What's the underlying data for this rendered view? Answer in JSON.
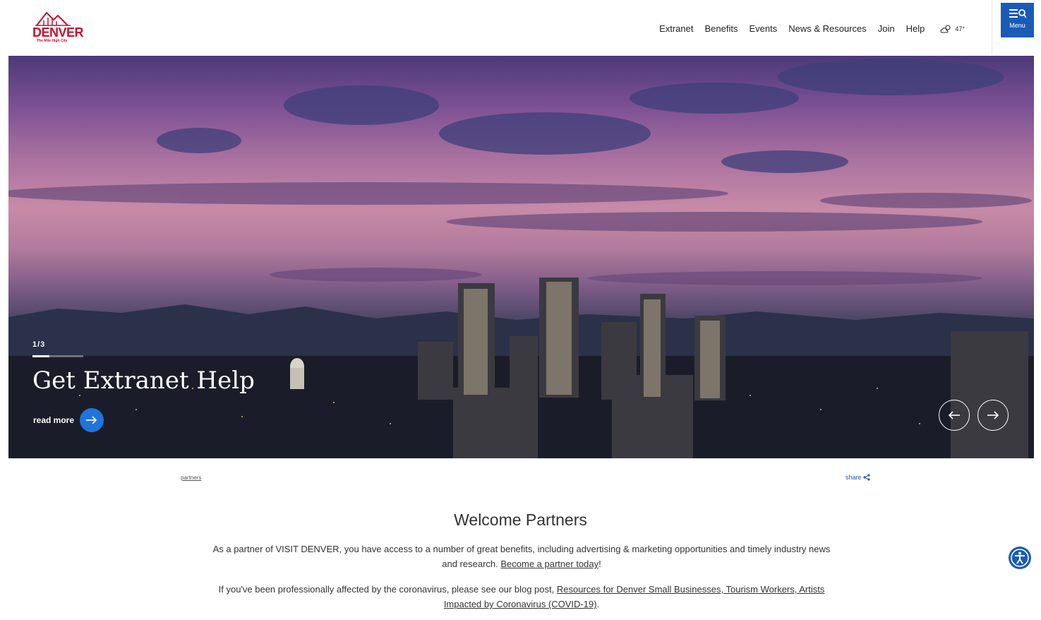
{
  "header": {
    "logo_word": "DENVER",
    "logo_tagline": "The Mile High City",
    "nav": [
      "Extranet",
      "Benefits",
      "Events",
      "News & Resources",
      "Join",
      "Help"
    ],
    "weather_temp": "47°",
    "menu_label": "Menu"
  },
  "hero": {
    "slide_counter": "1/3",
    "slide_progress": 0.333,
    "title": "Get Extranet Help",
    "read_more": "read more"
  },
  "content": {
    "breadcrumb": "partners",
    "share_label": "share",
    "welcome_title": "Welcome Partners",
    "p1_text": "As a partner of VISIT DENVER, you have access to a number of great benefits, including advertising & marketing opportunities and timely industry news and research.",
    "p1_link": "Become a partner today",
    "p1_end": "!",
    "p2_text": "If you've been professionally affected by the coronavirus, please see our blog post,",
    "p2_link": "Resources for Denver Small Businesses, Tourism Workers, Artists Impacted by Coronavirus (COVID-19)",
    "p2_end": "."
  },
  "colors": {
    "brand_red": "#c8102e",
    "accent_blue": "#1a5bb8",
    "button_blue": "#1f74db"
  }
}
